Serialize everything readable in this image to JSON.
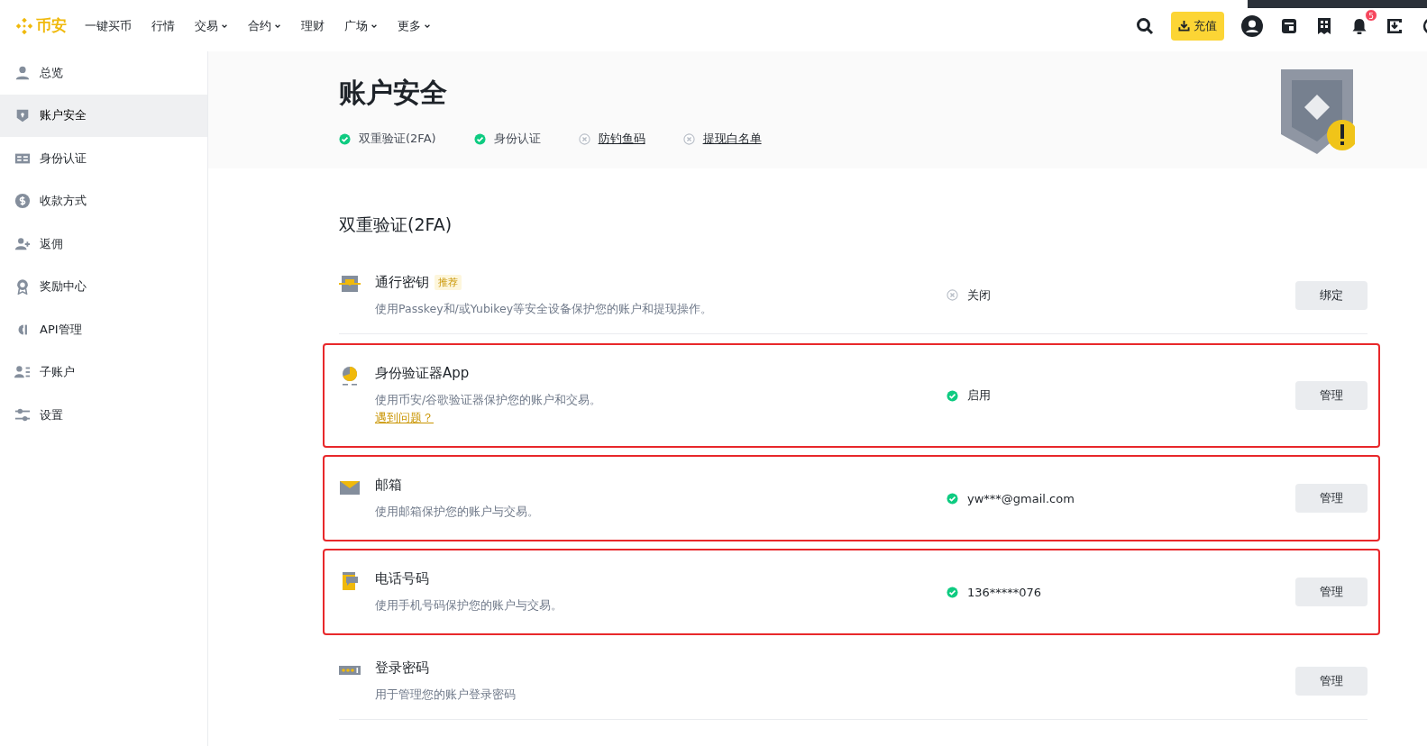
{
  "nav": {
    "brand": "币安",
    "items": [
      {
        "label": "一键买币",
        "dropdown": false
      },
      {
        "label": "行情",
        "dropdown": false
      },
      {
        "label": "交易",
        "dropdown": true
      },
      {
        "label": "合约",
        "dropdown": true
      },
      {
        "label": "理财",
        "dropdown": false
      },
      {
        "label": "广场",
        "dropdown": true
      },
      {
        "label": "更多",
        "dropdown": true
      }
    ],
    "deposit_button": "充值",
    "notification_count": "5"
  },
  "sidebar": {
    "items": [
      {
        "label": "总览",
        "kind": "person",
        "selected": false
      },
      {
        "label": "账户安全",
        "kind": "shield",
        "selected": true
      },
      {
        "label": "身份认证",
        "kind": "idcard",
        "selected": false
      },
      {
        "label": "收款方式",
        "kind": "dollar",
        "selected": false
      },
      {
        "label": "返佣",
        "kind": "adduser",
        "selected": false
      },
      {
        "label": "奖励中心",
        "kind": "award",
        "selected": false
      },
      {
        "label": "API管理",
        "kind": "api",
        "selected": false
      },
      {
        "label": "子账户",
        "kind": "subaccount",
        "selected": false
      },
      {
        "label": "设置",
        "kind": "sliders",
        "selected": false
      }
    ]
  },
  "header": {
    "title": "账户安全",
    "badges": [
      {
        "label": "双重验证(2FA)",
        "done": true
      },
      {
        "label": "身份认证",
        "done": true
      },
      {
        "label": "防钓鱼码",
        "done": false
      },
      {
        "label": "提现白名单",
        "done": false
      }
    ]
  },
  "section": {
    "title": "双重验证(2FA)",
    "rows": [
      {
        "kind": "passkey",
        "title": "通行密钥",
        "tag": "推荐",
        "description": "使用Passkey和/或Yubikey等安全设备保护您的账户和提现操作。",
        "status": "关闭",
        "enabled": false,
        "button": "绑定",
        "highlighted": false
      },
      {
        "kind": "authenticator",
        "title": "身份验证器App",
        "description": "使用币安/谷歌验证器保护您的账户和交易。",
        "link": "遇到问题？",
        "status": "启用",
        "enabled": true,
        "button": "管理",
        "highlighted": true
      },
      {
        "kind": "email",
        "title": "邮箱",
        "description": "使用邮箱保护您的账户与交易。",
        "status": "yw***@gmail.com",
        "enabled": true,
        "button": "管理",
        "highlighted": true
      },
      {
        "kind": "phone",
        "title": "电话号码",
        "description": "使用手机号码保护您的账户与交易。",
        "status": "136*****076",
        "enabled": true,
        "button": "管理",
        "highlighted": true
      },
      {
        "kind": "password",
        "title": "登录密码",
        "description": "用于管理您的账户登录密码",
        "button": "管理",
        "highlighted": false
      }
    ]
  }
}
